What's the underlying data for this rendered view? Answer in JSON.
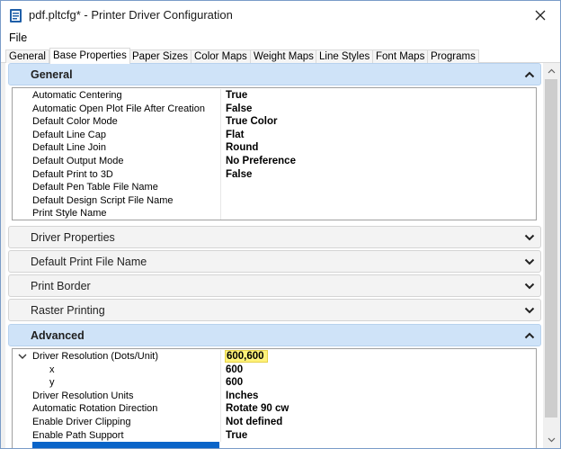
{
  "window": {
    "title": "pdf.pltcfg* - Printer Driver Configuration",
    "icon": "app-icon"
  },
  "menu": {
    "file": "File"
  },
  "tabs": [
    {
      "label": "General",
      "active": false
    },
    {
      "label": "Base Properties",
      "active": true
    },
    {
      "label": "Paper Sizes",
      "active": false
    },
    {
      "label": "Color Maps",
      "active": false
    },
    {
      "label": "Weight Maps",
      "active": false
    },
    {
      "label": "Line Styles",
      "active": false
    },
    {
      "label": "Font Maps",
      "active": false
    },
    {
      "label": "Programs",
      "active": false
    }
  ],
  "sections": {
    "general": {
      "title": "General",
      "expanded": true,
      "rows": [
        {
          "name": "Automatic Centering",
          "value": "True"
        },
        {
          "name": "Automatic Open Plot File After Creation",
          "value": "False"
        },
        {
          "name": "Default Color Mode",
          "value": "True Color"
        },
        {
          "name": "Default Line Cap",
          "value": "Flat"
        },
        {
          "name": "Default Line Join",
          "value": "Round"
        },
        {
          "name": "Default Output Mode",
          "value": "No Preference"
        },
        {
          "name": "Default Print to 3D",
          "value": "False"
        },
        {
          "name": "Default Pen Table File Name",
          "value": ""
        },
        {
          "name": "Default Design Script File Name",
          "value": ""
        },
        {
          "name": "Print Style Name",
          "value": ""
        }
      ]
    },
    "driver_properties": {
      "title": "Driver Properties",
      "expanded": false
    },
    "default_print_file_name": {
      "title": "Default Print File Name",
      "expanded": false
    },
    "print_border": {
      "title": "Print Border",
      "expanded": false
    },
    "raster_printing": {
      "title": "Raster Printing",
      "expanded": false
    },
    "advanced": {
      "title": "Advanced",
      "expanded": true,
      "rows": [
        {
          "name": "Driver Resolution (Dots/Unit)",
          "value": "600,600",
          "highlighted": true,
          "expandable": true
        },
        {
          "name": "x",
          "value": "600",
          "child": true
        },
        {
          "name": "y",
          "value": "600",
          "child": true
        },
        {
          "name": "Driver Resolution Units",
          "value": "Inches"
        },
        {
          "name": "Automatic Rotation Direction",
          "value": "Rotate 90 cw"
        },
        {
          "name": "Enable Driver Clipping",
          "value": "Not defined"
        },
        {
          "name": "Enable Path Support",
          "value": "True"
        }
      ]
    }
  },
  "colors": {
    "accent": "#0a64c8",
    "section_expanded_bg": "#cfe3f8",
    "highlight": "#fff27a"
  }
}
